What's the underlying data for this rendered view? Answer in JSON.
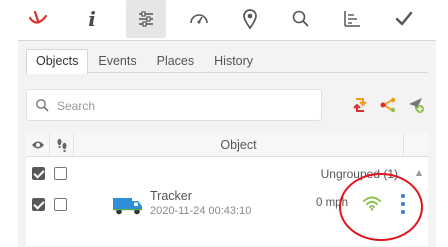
{
  "toolbar": {
    "buttons": [
      {
        "name": "logo-icon"
      },
      {
        "name": "info-icon",
        "glyph": "i"
      },
      {
        "name": "settings-icon",
        "active": true
      },
      {
        "name": "dashboard-icon"
      },
      {
        "name": "location-pin-icon"
      },
      {
        "name": "search-icon"
      },
      {
        "name": "chart-icon"
      },
      {
        "name": "check-icon",
        "glyph": "✔"
      }
    ]
  },
  "tabs": [
    {
      "label": "Objects",
      "active": true
    },
    {
      "label": "Events"
    },
    {
      "label": "Places"
    },
    {
      "label": "History"
    }
  ],
  "search": {
    "placeholder": "Search",
    "value": ""
  },
  "actions": [
    "refresh-icon",
    "share-icon",
    "add-icon"
  ],
  "table": {
    "columns": {
      "visibility_icon": "eye-icon",
      "follow_icon": "footprints-icon",
      "object": "Object"
    },
    "group": {
      "label": "Ungrouped (1)",
      "visible": true,
      "follow": false
    },
    "rows": [
      {
        "visible": true,
        "follow": false,
        "icon": "truck-icon",
        "name": "Tracker",
        "time": "2020-11-24 00:43:10",
        "speed": "0 mph",
        "signal": "wifi-icon"
      }
    ]
  },
  "colors": {
    "accent_orange": "#f39c12",
    "accent_green": "#8bc34a",
    "accent_red": "#d9302c",
    "kebab_blue": "#3a7bd5",
    "annotation_red": "#e0141e"
  }
}
